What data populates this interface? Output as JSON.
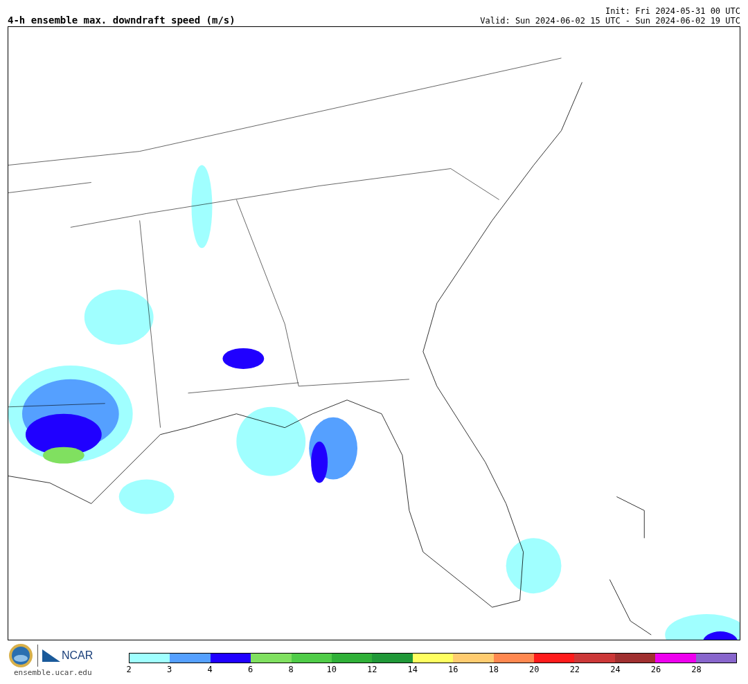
{
  "title": "4-h ensemble max. downdraft speed (m/s)",
  "init": "Init: Fri 2024-05-31 00 UTC",
  "valid": "Valid: Sun 2024-06-02 15 UTC - Sun 2024-06-02 19 UTC",
  "logo": {
    "org": "NCAR",
    "url": "ensemble.ucar.edu"
  },
  "colorbar": {
    "segments": [
      {
        "color": "#a0ffff"
      },
      {
        "color": "#55a0ff"
      },
      {
        "color": "#2000ff"
      },
      {
        "color": "#80e060"
      },
      {
        "color": "#50cc48"
      },
      {
        "color": "#30b038"
      },
      {
        "color": "#209838"
      },
      {
        "color": "#ffff60"
      },
      {
        "color": "#ffcc70"
      },
      {
        "color": "#ff8850"
      },
      {
        "color": "#ff1c1c"
      },
      {
        "color": "#cc3838"
      },
      {
        "color": "#a03030"
      },
      {
        "color": "#ee00ee"
      },
      {
        "color": "#8866cc"
      }
    ],
    "ticks": [
      "2",
      "3",
      "4",
      "6",
      "8",
      "10",
      "12",
      "14",
      "16",
      "18",
      "20",
      "22",
      "24",
      "26",
      "28"
    ]
  }
}
